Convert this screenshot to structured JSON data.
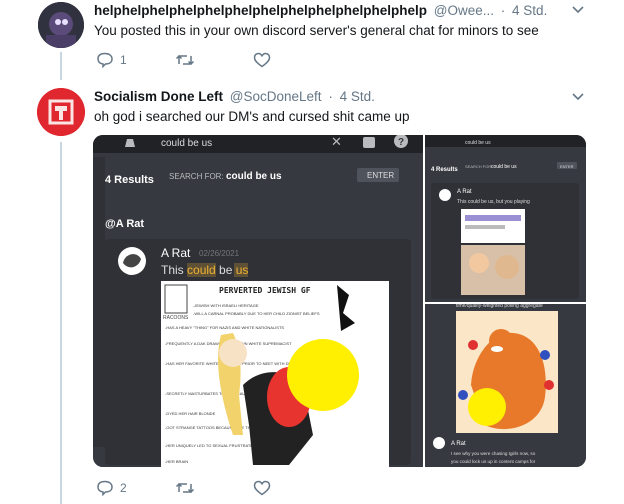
{
  "tweet1": {
    "name": "helphelphelphelphelphelphelphelphelphelphelphelp",
    "handle": "@Owee...",
    "time": "4 Std.",
    "text": "You posted this in your own discord server's general chat for minors to see",
    "reply_count": "1",
    "retweet_count": "",
    "like_count": ""
  },
  "tweet2": {
    "name": "Socialism Done Left",
    "handle": "@SocDoneLeft",
    "time": "4 Std.",
    "text": "oh god i searched our DM's and cursed shit came up",
    "reply_count": "2",
    "retweet_count": "",
    "like_count": ""
  },
  "discord": {
    "search_query": "could be us",
    "results_count": "4 Results",
    "search_for_label": "SEARCH FOR:",
    "search_term": "could be us",
    "enter_label": "ENTER",
    "channel": "@A Rat",
    "author": "A Rat",
    "date": "02/26/2021",
    "message_prefix": "This ",
    "message_highlight": "could",
    "message_middle": " be ",
    "message_highlight2": "us",
    "meme_title": "PERVERTED JEWISH GF",
    "meme_logo_text": "RACOONS",
    "meme_bullets": [
      "-JEWISH WITH ISRAELI HERITAGE",
      "-WILL A CARNAL PROBABLY DUE TO HER CHILD ZIONIST BELIEFS",
      "-HAS A HEAVY \"THING\" FOR NAZIS AND WHITE NATIONALISTS",
      "-FREQUENTLY A DAK DRAWS BY A KNOWN WHITE SUPREMACIST",
      "-HAS HER FAVORITE WHITE GENOCIDE PRIOR TO NEET WITH DRESSED OUT IN PUBLIC",
      "-SECRETLY MASTURBATES TO HOLOCAUST FOOTAGE",
      "-DYED HER HAIR BLONDE",
      "-GOT STRANGE TATTOOS BECAUSE SHE THOUGHT THEY LOOKED HOT",
      "-HER UNIQUELY LED TO SEXUAL FRUSTRATION",
      "-HER BRAIN"
    ],
    "right_top": {
      "results": "4 Results",
      "search_for": "SEARCH FOR:",
      "term": "could be us",
      "enter": "ENTER",
      "author": "A Rat",
      "message": "This could be us, but you playing"
    },
    "right_bottom": {
      "caption": "time/quality-weighted polling aggregate",
      "author": "A Rat",
      "message_line1": "I see why you were chasing tgirls now, so",
      "message_line2": "you could lock us up in content camps for"
    }
  },
  "colors": {
    "discord_bg": "#36393f",
    "discord_dark": "#202225",
    "highlight": "#f0b232",
    "link_blue": "#1da1f2",
    "avatar_red": "#e0262e"
  }
}
